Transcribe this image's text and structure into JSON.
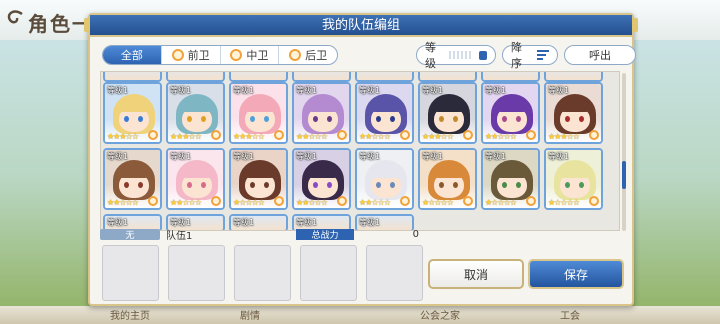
{
  "background": {
    "title": "角色一",
    "footer_items": [
      "我的主页",
      "剧情",
      "公会之家",
      "工会"
    ]
  },
  "dialog": {
    "title": "我的队伍编组",
    "tabs": [
      {
        "label": "全部",
        "active": true
      },
      {
        "label": "前卫",
        "active": false
      },
      {
        "label": "中卫",
        "active": false
      },
      {
        "label": "后卫",
        "active": false
      }
    ],
    "level_label": "等级",
    "sort_label": "降序",
    "call_label": "呼出"
  },
  "roster": {
    "level_text": "等级1",
    "cards": [
      {
        "row": 1,
        "col": 0,
        "hair": "#f0d27a",
        "bg": "#cfe3f5",
        "eye": "#3b7bd6",
        "stars": 3
      },
      {
        "row": 1,
        "col": 1,
        "hair": "#7fb6c4",
        "bg": "#d9dfe8",
        "eye": "#e0a020",
        "stars": 3
      },
      {
        "row": 1,
        "col": 2,
        "hair": "#f4a9b8",
        "bg": "#fbe2ea",
        "eye": "#4fa0d8",
        "stars": 3
      },
      {
        "row": 1,
        "col": 3,
        "hair": "#b48ad0",
        "bg": "#e2d6ee",
        "eye": "#6a3a8a",
        "stars": 2
      },
      {
        "row": 1,
        "col": 4,
        "hair": "#5a54a8",
        "bg": "#dcd8f0",
        "eye": "#2a3a8a",
        "stars": 2
      },
      {
        "row": 1,
        "col": 5,
        "hair": "#2a2a3a",
        "bg": "#d6d6de",
        "eye": "#c08a2a",
        "stars": 3
      },
      {
        "row": 1,
        "col": 6,
        "hair": "#6a3aa8",
        "bg": "#e2d6f0",
        "eye": "#a84a8a",
        "stars": 2
      },
      {
        "row": 1,
        "col": 7,
        "hair": "#6a3a2a",
        "bg": "#eadcd4",
        "eye": "#a82a2a",
        "stars": 3
      },
      {
        "row": 2,
        "col": 0,
        "hair": "#8a5a3a",
        "bg": "#e6d8cc",
        "eye": "#8a3a2a",
        "stars": 2
      },
      {
        "row": 2,
        "col": 1,
        "hair": "#f4b8c8",
        "bg": "#fbe6ee",
        "eye": "#d86a8a",
        "stars": 2
      },
      {
        "row": 2,
        "col": 2,
        "hair": "#6a3a2a",
        "bg": "#ead4c8",
        "eye": "#6a3a2a",
        "stars": 1
      },
      {
        "row": 2,
        "col": 3,
        "hair": "#3a2a4a",
        "bg": "#d8d0e4",
        "eye": "#8a4ac8",
        "stars": 2
      },
      {
        "row": 2,
        "col": 4,
        "hair": "#e6e6ee",
        "bg": "#eef0f4",
        "eye": "#6a8ab8",
        "stars": 2
      },
      {
        "row": 2,
        "col": 5,
        "hair": "#d88a3a",
        "bg": "#f4e0c8",
        "eye": "#8a5a2a",
        "stars": 1
      },
      {
        "row": 2,
        "col": 6,
        "hair": "#6a5a3a",
        "bg": "#dcd8c4",
        "eye": "#4a8a4a",
        "stars": 1
      },
      {
        "row": 2,
        "col": 7,
        "hair": "#e8e4a0",
        "bg": "#eef0d8",
        "eye": "#4a9a5a",
        "stars": 1
      }
    ]
  },
  "team": {
    "number": "无",
    "name": "队伍1",
    "power_label": "总战力",
    "power_value": "0"
  },
  "buttons": {
    "cancel": "取消",
    "save": "保存"
  }
}
